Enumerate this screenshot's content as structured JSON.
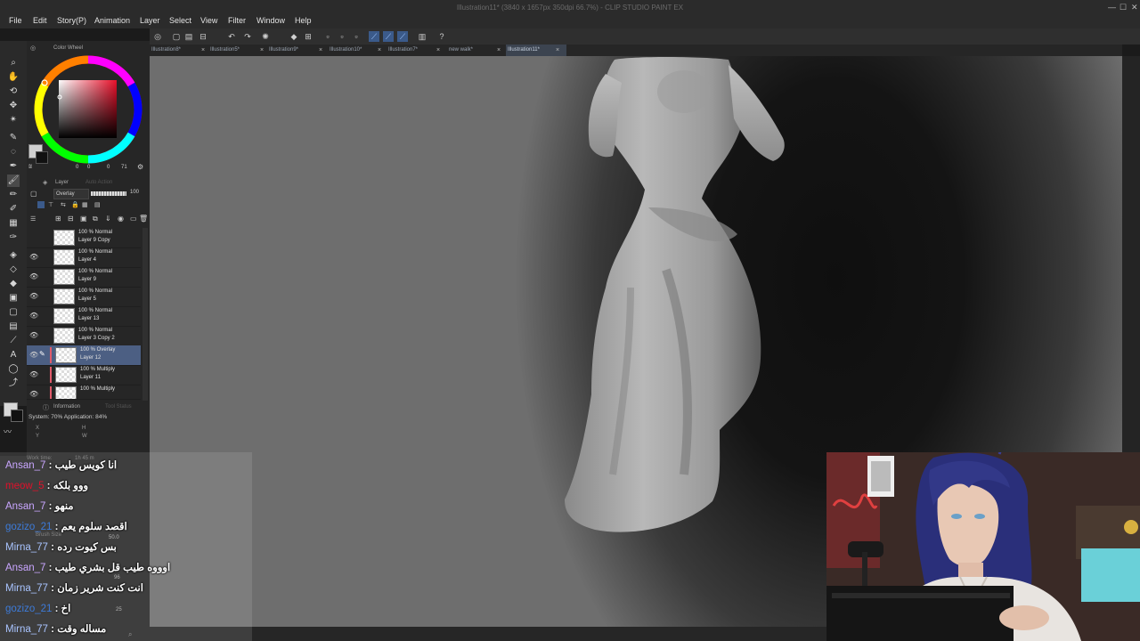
{
  "window": {
    "title": "Illustration11* (3840 x 1657px 350dpi 66.7%) - CLIP STUDIO PAINT EX",
    "minimize": "—",
    "maximize": "☐",
    "close": "✕"
  },
  "menu": [
    "File",
    "Edit",
    "Story(P)",
    "Animation",
    "Layer",
    "Select",
    "View",
    "Filter",
    "Window",
    "Help"
  ],
  "tabs": [
    {
      "label": "Illustration8*",
      "active": false
    },
    {
      "label": "Illustration5*",
      "active": false
    },
    {
      "label": "Illustration9*",
      "active": false
    },
    {
      "label": "Illustration10*",
      "active": false
    },
    {
      "label": "Illustration7*",
      "active": false
    },
    {
      "label": "new walk*",
      "active": false
    },
    {
      "label": "Illustration11*",
      "active": true
    }
  ],
  "tab_close": "×",
  "color_panel": {
    "title": "Color Wheel",
    "values": [
      "0",
      "0",
      "0",
      "71"
    ]
  },
  "layer_panel": {
    "title": "Layer",
    "title2": "Auto Action",
    "blend_mode": "Overlay",
    "opacity": "100",
    "layers": [
      {
        "line1": "100 % Normal",
        "line2": "Layer 9 Copy",
        "visible": false,
        "selected": false,
        "stripe": false
      },
      {
        "line1": "100 % Normal",
        "line2": "Layer 4",
        "visible": true,
        "selected": false,
        "stripe": false
      },
      {
        "line1": "100 % Normal",
        "line2": "Layer 9",
        "visible": true,
        "selected": false,
        "stripe": false
      },
      {
        "line1": "100 % Normal",
        "line2": "Layer 5",
        "visible": true,
        "selected": false,
        "stripe": false
      },
      {
        "line1": "100 % Normal",
        "line2": "Layer 13",
        "visible": true,
        "selected": false,
        "stripe": false
      },
      {
        "line1": "100 % Normal",
        "line2": "Layer 3 Copy 2",
        "visible": true,
        "selected": false,
        "stripe": false
      },
      {
        "line1": "100 % Overlay",
        "line2": "Layer 12",
        "visible": true,
        "selected": true,
        "stripe": true
      },
      {
        "line1": "100 % Multiply",
        "line2": "Layer 11",
        "visible": true,
        "selected": false,
        "stripe": true
      },
      {
        "line1": "100 % Multiply",
        "line2": "",
        "visible": true,
        "selected": false,
        "stripe": true
      }
    ]
  },
  "info_panel": {
    "title": "Information",
    "title2": "Tool Status",
    "status": "System: 70%  Application: 84%",
    "x_label": "X",
    "y_label": "Y",
    "h_label": "H",
    "w_label": "W",
    "work_time": "Work time:",
    "work_value": "1h 45 m"
  },
  "chat": [
    {
      "user": "Ansan_7",
      "color": "#c9a6ff",
      "msg": "انا كويس طيب"
    },
    {
      "user": "meow_5",
      "color": "#e0102a",
      "msg": "ووو بلكه"
    },
    {
      "user": "Ansan_7",
      "color": "#c9a6ff",
      "msg": "منهو"
    },
    {
      "user": "gozizo_21",
      "color": "#3d7bd9",
      "msg": "اقصد سلوم يعم"
    },
    {
      "user": "Mirna_77",
      "color": "#a9c4ff",
      "msg": "بس كيوت رده"
    },
    {
      "user": "Ansan_7",
      "color": "#c9a6ff",
      "msg": "اوووه طيب قل بشري طيب"
    },
    {
      "user": "Mirna_77",
      "color": "#a9c4ff",
      "msg": "انت كنت شرير زمان"
    },
    {
      "user": "gozizo_21",
      "color": "#3d7bd9",
      "msg": "اخ"
    },
    {
      "user": "Mirna_77",
      "color": "#a9c4ff",
      "msg": "مساله وقت"
    }
  ],
  "chat_separator": " : ",
  "subtool": {
    "brush_size_label": "Brush Size",
    "brush_size": "50.0",
    "paint_amount": "96",
    "third_value": "25"
  },
  "colors": {
    "accent_blue": "#3b5a8a",
    "selected_layer": "#4c5f83",
    "canvas_dark": "#141414",
    "canvas_light": "#6e6e6e"
  }
}
